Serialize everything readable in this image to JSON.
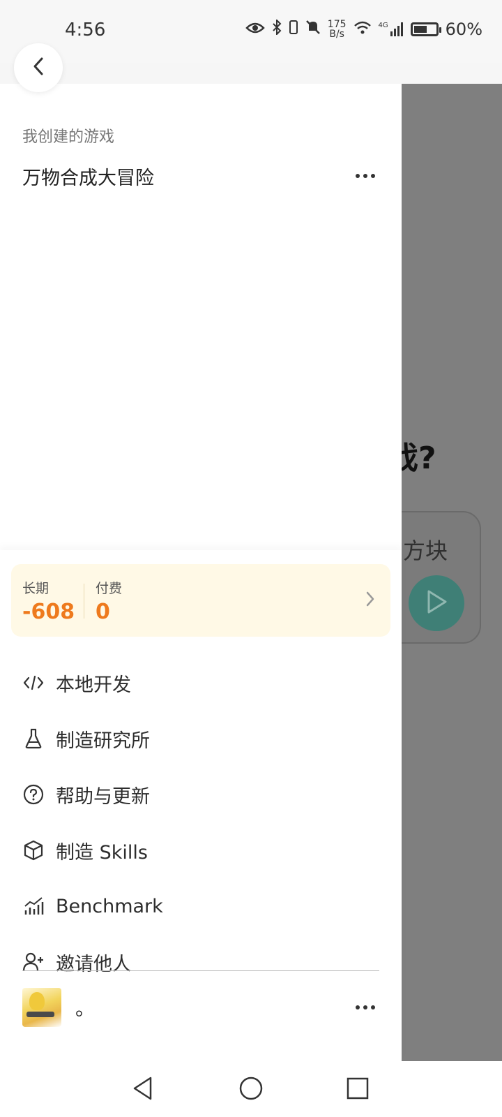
{
  "status_bar": {
    "time": "4:56",
    "net_speed_value": "175",
    "net_speed_unit": "B/s",
    "network_type": "4G",
    "battery_percent": "60%",
    "battery_level": 0.6,
    "icons": [
      "eye-icon",
      "bluetooth-icon",
      "vibrate-icon",
      "mute-icon",
      "wifi-icon",
      "signal-icon",
      "battery-icon"
    ]
  },
  "back_button": {
    "icon": "chevron-left-icon"
  },
  "drawer": {
    "section_title": "我创建的游戏",
    "games": [
      {
        "name": "万物合成大冒险"
      }
    ],
    "credits": {
      "long_term_label": "长期",
      "long_term_value": "-608",
      "paid_label": "付费",
      "paid_value": "0",
      "accent_color": "#ee7a1d",
      "bg_color": "#fff9e6"
    },
    "menu": [
      {
        "label": "本地开发",
        "icon": "code-icon"
      },
      {
        "label": "制造研究所",
        "icon": "flask-icon"
      },
      {
        "label": "帮助与更新",
        "icon": "help-circle-icon"
      },
      {
        "label": "制造 Skills",
        "icon": "cube-icon"
      },
      {
        "label": "Benchmark",
        "icon": "chart-icon"
      },
      {
        "label": "邀请他人",
        "icon": "user-plus-icon"
      }
    ],
    "profile": {
      "username": "。"
    }
  },
  "background_app": {
    "question_fragment": "戏?",
    "card_text": "方块",
    "play_color": "#3f7f76"
  },
  "nav_bar": {
    "icons": [
      "back-triangle-icon",
      "home-circle-icon",
      "recents-square-icon"
    ]
  }
}
